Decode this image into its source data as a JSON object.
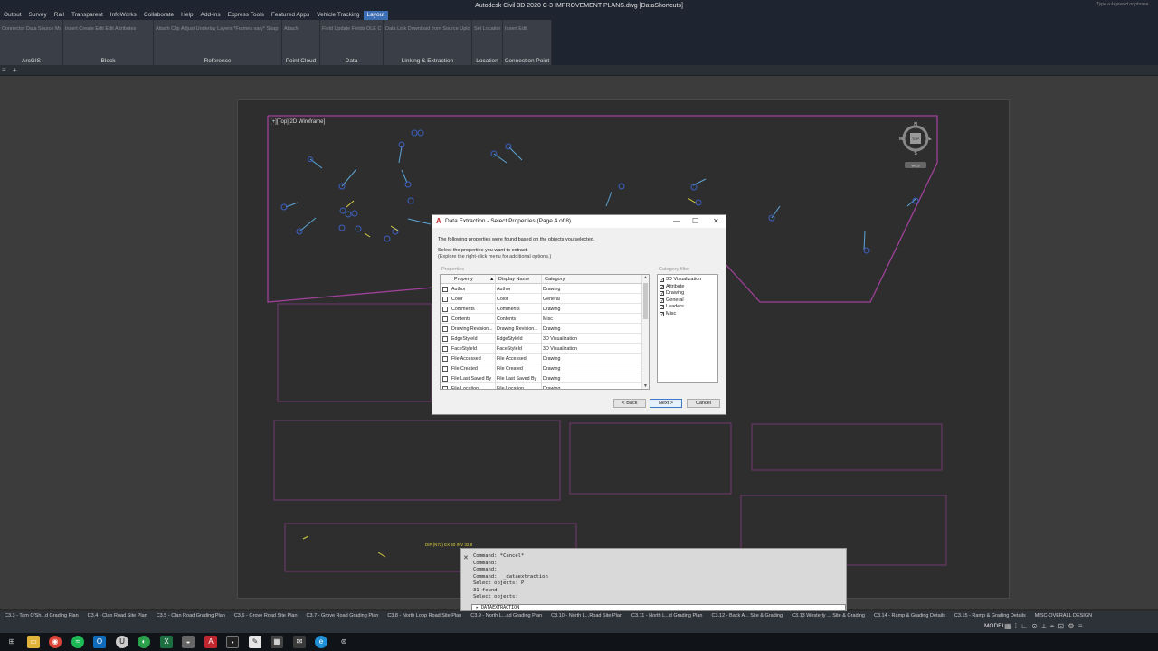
{
  "window": {
    "title": "Autodesk Civil 3D 2020   C-3 IMPROVEMENT PLANS.dwg [DataShortcuts]",
    "search_placeholder": "Type a keyword or phrase"
  },
  "ribbon_tabs": [
    "Output",
    "Survey",
    "Rail",
    "Transparent",
    "InfoWorks",
    "Collaborate",
    "Help",
    "Add-ins",
    "Express Tools",
    "Featured Apps",
    "Vehicle Tracking",
    "Layout"
  ],
  "ribbon_active_tab": "Layout",
  "ribbon_groups": [
    {
      "label": "ArcGIS",
      "items": "Connector  Data Source Manager"
    },
    {
      "label": "Block",
      "items": "Insert  Create  Edit  Edit Attributes"
    },
    {
      "label": "Reference",
      "items": "Attach  Clip  Adjust  Underlay Layers  *Frames vary*  Snap to Underlays ON"
    },
    {
      "label": "Point Cloud",
      "items": "Attach"
    },
    {
      "label": "Data",
      "items": "Field  Update Fields  OLE Object  Hyperlink"
    },
    {
      "label": "Linking & Extraction",
      "items": "Data Link  Download from Source  Upload to Source  Extract Data"
    },
    {
      "label": "Location",
      "items": "Set Location"
    },
    {
      "label": "Connection Point",
      "items": "Insert  Edit"
    }
  ],
  "viewport_label": "[+][Top][2D Wireframe]",
  "compass": {
    "n": "N",
    "s": "S",
    "e": "E",
    "w": "W",
    "top": "TOP",
    "wcs": "WCS"
  },
  "drawing_note": "DIP (N72) EX 50 INV 32.8",
  "dialog": {
    "title": "Data Extraction - Select Properties (Page 4 of 8)",
    "desc1": "The following properties were found based on the objects you selected.",
    "desc2": "Select the properties you want to extract.",
    "desc3": "(Explore the right-click menu for additional options.)",
    "properties_label": "Properties",
    "columns": {
      "property": "Property",
      "display": "Display Name",
      "category": "Category"
    },
    "rows": [
      {
        "property": "Author",
        "display": "Author",
        "category": "Drawing"
      },
      {
        "property": "Color",
        "display": "Color",
        "category": "General"
      },
      {
        "property": "Comments",
        "display": "Comments",
        "category": "Drawing"
      },
      {
        "property": "Contents",
        "display": "Contents",
        "category": "Misc"
      },
      {
        "property": "Drawing Revision...",
        "display": "Drawing Revision...",
        "category": "Drawing"
      },
      {
        "property": "EdgeStyleId",
        "display": "EdgeStyleId",
        "category": "3D Visualization"
      },
      {
        "property": "FaceStyleId",
        "display": "FaceStyleId",
        "category": "3D Visualization"
      },
      {
        "property": "File Accessed",
        "display": "File Accessed",
        "category": "Drawing"
      },
      {
        "property": "File Created",
        "display": "File Created",
        "category": "Drawing"
      },
      {
        "property": "File Last Saved By",
        "display": "File Last Saved By",
        "category": "Drawing"
      },
      {
        "property": "File Location",
        "display": "File Location",
        "category": "Drawing"
      }
    ],
    "category_filter_label": "Category filter",
    "categories": [
      {
        "name": "3D Visualization",
        "checked": "✓"
      },
      {
        "name": "Attribute",
        "checked": "✓"
      },
      {
        "name": "Drawing",
        "checked": "✓"
      },
      {
        "name": "General",
        "checked": "✓"
      },
      {
        "name": "Leaders",
        "checked": "✓"
      },
      {
        "name": "Misc",
        "checked": "✓"
      }
    ],
    "buttons": {
      "back": "< Back",
      "next": "Next >",
      "cancel": "Cancel"
    }
  },
  "command_window": {
    "lines": [
      "Command: *Cancel*",
      "Command:",
      "Command:",
      "Command:  _dataextraction",
      "Select objects: P",
      "31 found",
      "Select objects:"
    ],
    "input": "DATAEXTRACTION"
  },
  "layout_tabs": [
    "C3.3 - Tam O'Sh...d Grading Plan",
    "C3.4 - Clan Road Site Plan",
    "C3.5 - Clan Road Grading Plan",
    "C3.6 - Grove Road Site Plan",
    "C3.7 - Grove Road Grading Plan",
    "C3.8 - North Loop Road Site Plan",
    "C3.9 - North L...ad Grading Plan",
    "C3.10 - North L...Road Site Plan",
    "C3.11 - North L...d Grading Plan",
    "C3.12 - Back A... Site & Grading",
    "C3.13 Westerly ... Site & Grading",
    "C3.14 - Ramp & Grading Details",
    "C3.15 - Ramp & Grading Details",
    "MISC-OVERALL DESIGN"
  ],
  "status": {
    "model": "MODEL"
  },
  "colors": {
    "accent": "#3d6fb5",
    "viewport_border": "#b04aa8",
    "sheet": "#2e2e2e"
  }
}
